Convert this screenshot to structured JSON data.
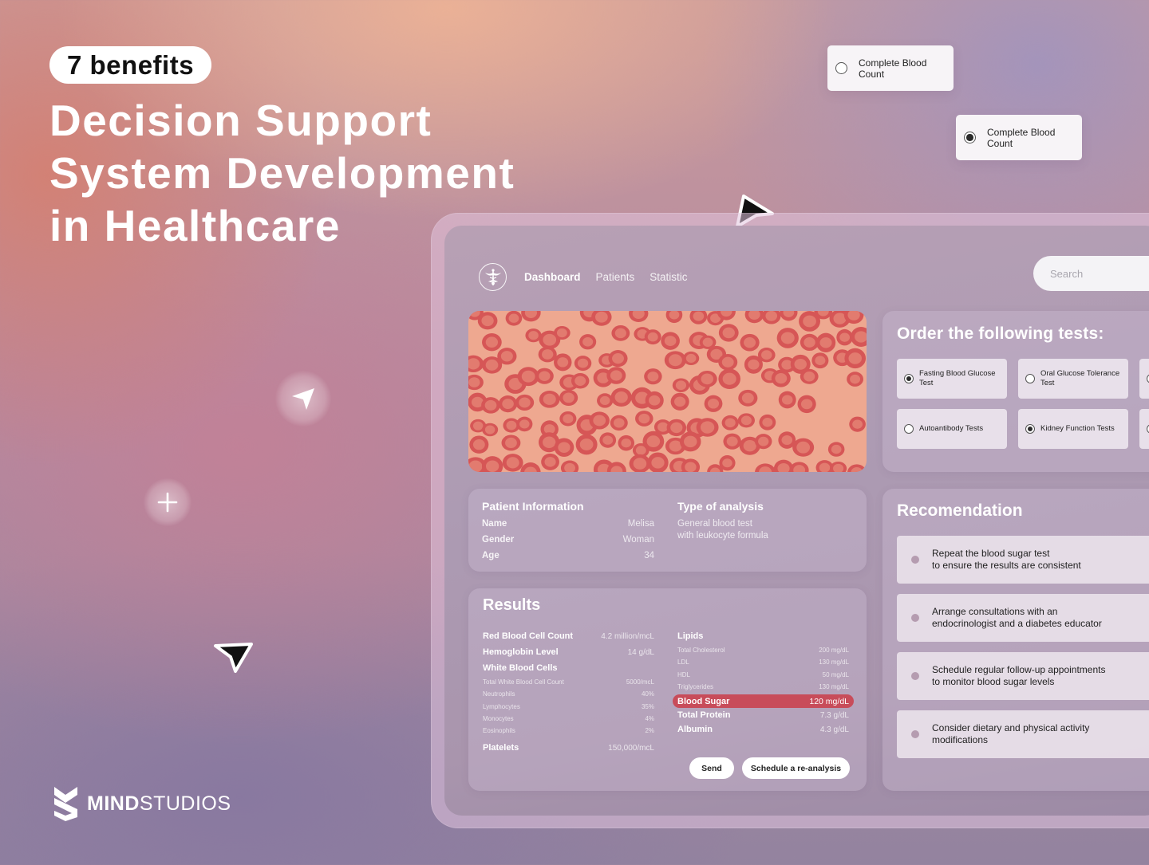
{
  "hero": {
    "badge": "7 benefits",
    "title_lines": [
      "Decision Support",
      "System Development",
      "in Healthcare"
    ]
  },
  "floating_cards": [
    {
      "label": "Complete Blood Count",
      "checked": false
    },
    {
      "label": "Complete Blood Count",
      "checked": true
    }
  ],
  "decor_icons": {
    "send_bubble": "paper-plane-icon",
    "plus_bubble": "plus-icon",
    "cursor_top": "pointer-cursor-icon",
    "cursor_bottom": "pointer-cursor-icon"
  },
  "brand": {
    "logo_bold": "MIND",
    "logo_light": "STUDIOS"
  },
  "app": {
    "nav": {
      "logo_icon": "caduceus-icon",
      "items": [
        {
          "label": "Dashboard",
          "active": true
        },
        {
          "label": "Patients",
          "active": false
        },
        {
          "label": "Statistic",
          "active": false
        }
      ],
      "search_placeholder": "Search",
      "search_value": ""
    },
    "image_caption": "blood-smear-microscopy-image",
    "patient_info": {
      "title": "Patient Information",
      "rows": [
        {
          "label": "Name",
          "value": "Melisa"
        },
        {
          "label": "Gender",
          "value": "Woman"
        },
        {
          "label": "Age",
          "value": "34"
        }
      ],
      "analysis_title": "Type of analysis",
      "analysis_lines": [
        "General blood test",
        "with leukocyte formula"
      ]
    },
    "results": {
      "title": "Results",
      "left": {
        "main": [
          {
            "label": "Red Blood Cell Count",
            "value": "4.2 million/mcL"
          },
          {
            "label": "Hemoglobin Level",
            "value": "14 g/dL"
          }
        ],
        "wbc_title": "White Blood Cells",
        "wbc": [
          {
            "label": "Total White Blood Cell Count",
            "value": "5000/mcL"
          },
          {
            "label": "Neutrophils",
            "value": "40%"
          },
          {
            "label": "Lymphocytes",
            "value": "35%"
          },
          {
            "label": "Monocytes",
            "value": "4%"
          },
          {
            "label": "Eosinophils",
            "value": "2%"
          }
        ],
        "platelets": {
          "label": "Platelets",
          "value": "150,000/mcL"
        }
      },
      "right": {
        "lipids_title": "Lipids",
        "lipids": [
          {
            "label": "Total Cholesterol",
            "value": "200 mg/dL"
          },
          {
            "label": "LDL",
            "value": "130 mg/dL"
          },
          {
            "label": "HDL",
            "value": "50 mg/dL"
          },
          {
            "label": "Triglycerides",
            "value": "130 mg/dL"
          }
        ],
        "highlight": {
          "label": "Blood Sugar",
          "value": "120 mg/dL",
          "color": "#c84c5a"
        },
        "others": [
          {
            "label": "Total Protein",
            "value": "7.3 g/dL"
          },
          {
            "label": "Albumin",
            "value": "4.3 g/dL"
          }
        ]
      },
      "send_label": "Send",
      "schedule_label": "Schedule a re-analysis"
    },
    "order_tests": {
      "title": "Order the following tests:",
      "tests": [
        {
          "label": "Fasting Blood Glucose Test",
          "checked": true
        },
        {
          "label": "Oral Glucose Tolerance Test",
          "checked": false
        },
        {
          "label": "",
          "checked": true
        },
        {
          "label": "Autoantibody Tests",
          "checked": false
        },
        {
          "label": "Kidney Function Tests",
          "checked": true
        },
        {
          "label": "",
          "checked": false
        }
      ]
    },
    "recommendation": {
      "title": "Recomendation",
      "items": [
        {
          "line1": "Repeat the blood sugar test",
          "line2": "to ensure the results are consistent"
        },
        {
          "line1": "Arrange consultations with an",
          "line2": "endocrinologist and a diabetes educator"
        },
        {
          "line1": "Schedule regular follow-up appointments",
          "line2": "to monitor blood sugar levels"
        },
        {
          "line1": "Consider dietary and physical activity",
          "line2": "modifications"
        }
      ]
    }
  }
}
